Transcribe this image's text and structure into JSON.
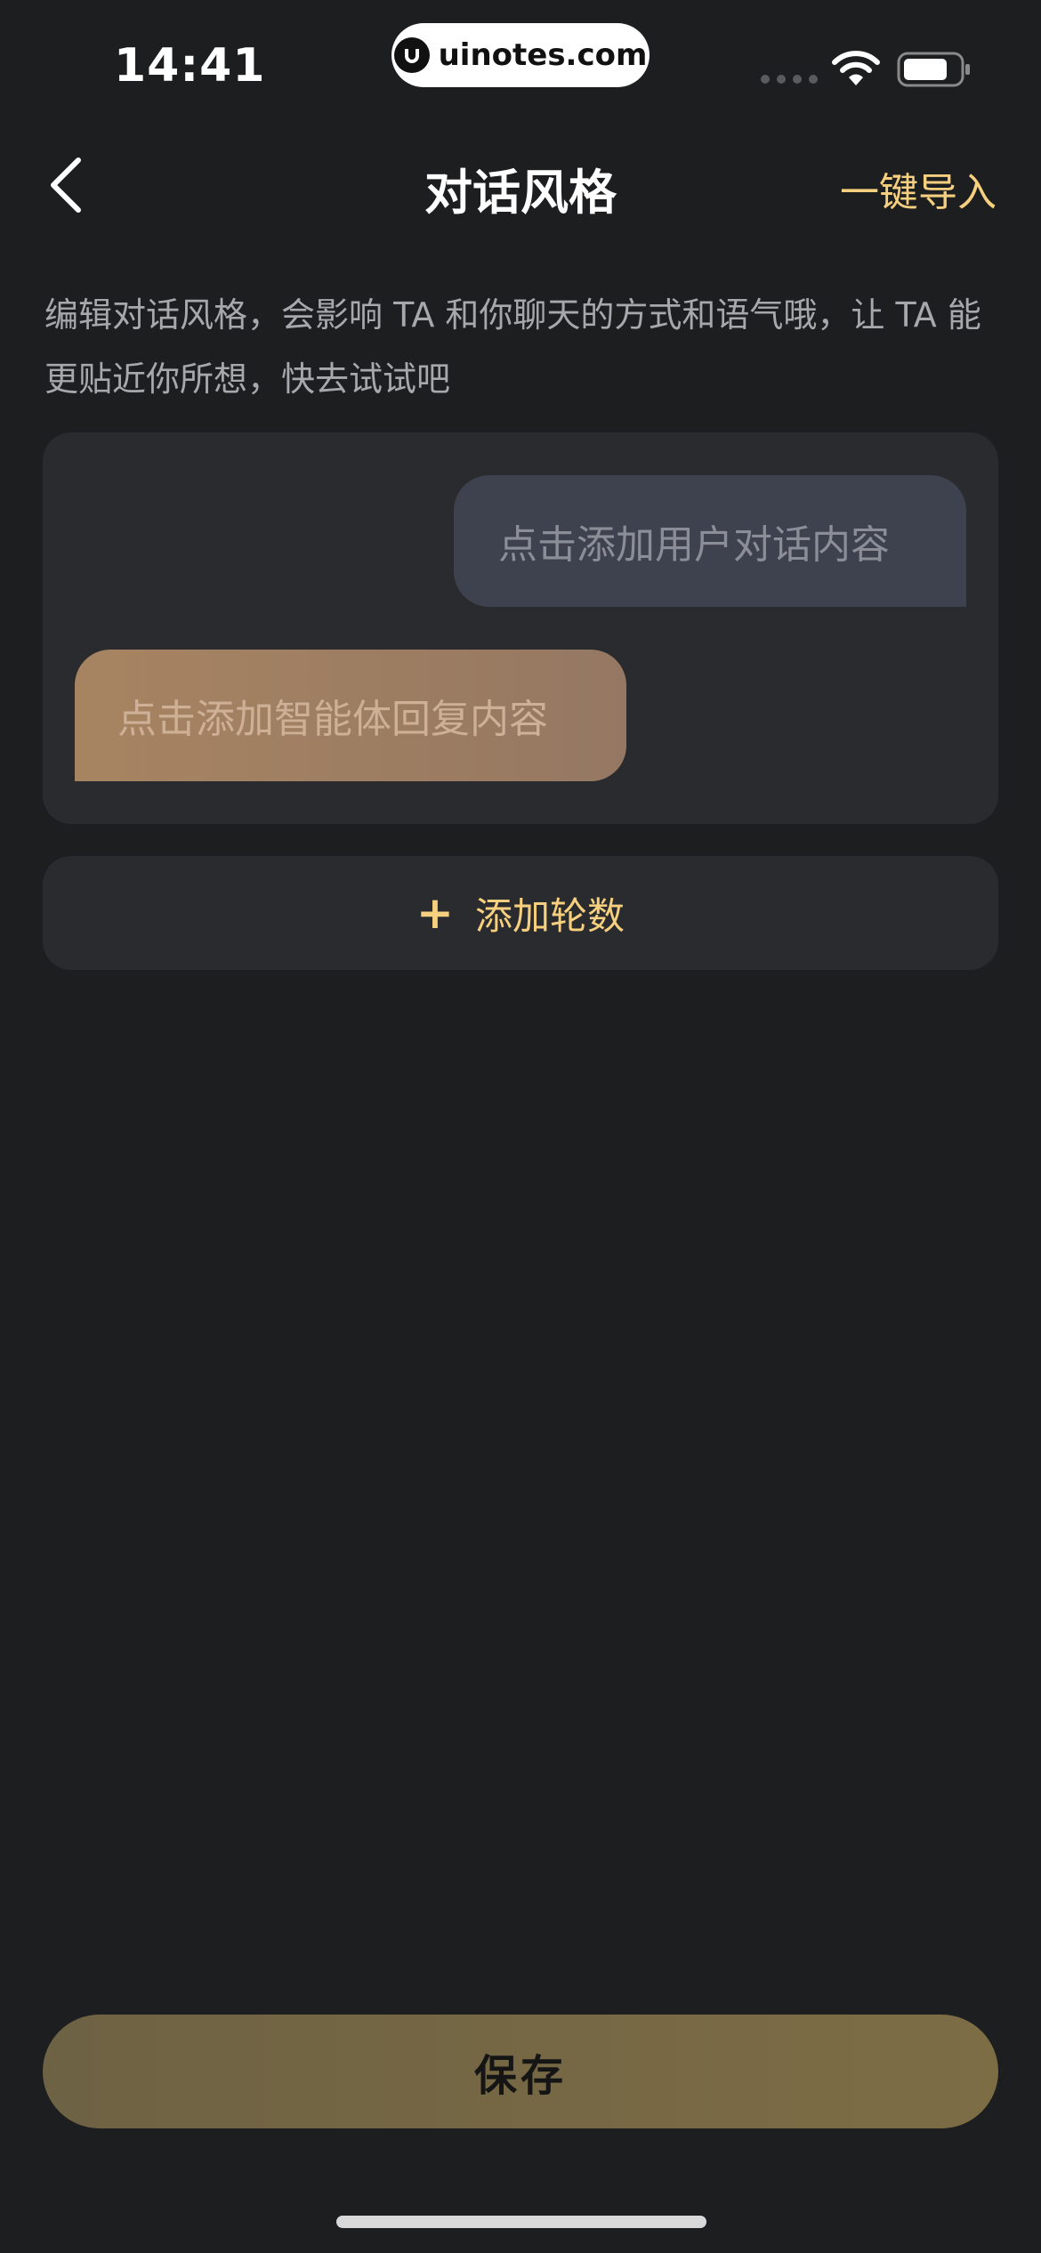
{
  "status_bar": {
    "time": "14:41",
    "watermark": "uinotes.com"
  },
  "nav": {
    "title": "对话风格",
    "action": "一键导入"
  },
  "description": "编辑对话风格，会影响 TA 和你聊天的方式和语气哦，让 TA 能更贴近你所想，快去试试吧",
  "dialogue": {
    "user_placeholder": "点击添加用户对话内容",
    "agent_placeholder": "点击添加智能体回复内容"
  },
  "add_round": {
    "icon": "plus-icon",
    "label": "添加轮数"
  },
  "save_label": "保存",
  "colors": {
    "background": "#1d1e20",
    "card": "#2a2b2e",
    "accent": "#f6cf7f",
    "user_bubble": "#3e424f",
    "agent_bubble": "#a78461",
    "save_button": "#7d6d45"
  }
}
